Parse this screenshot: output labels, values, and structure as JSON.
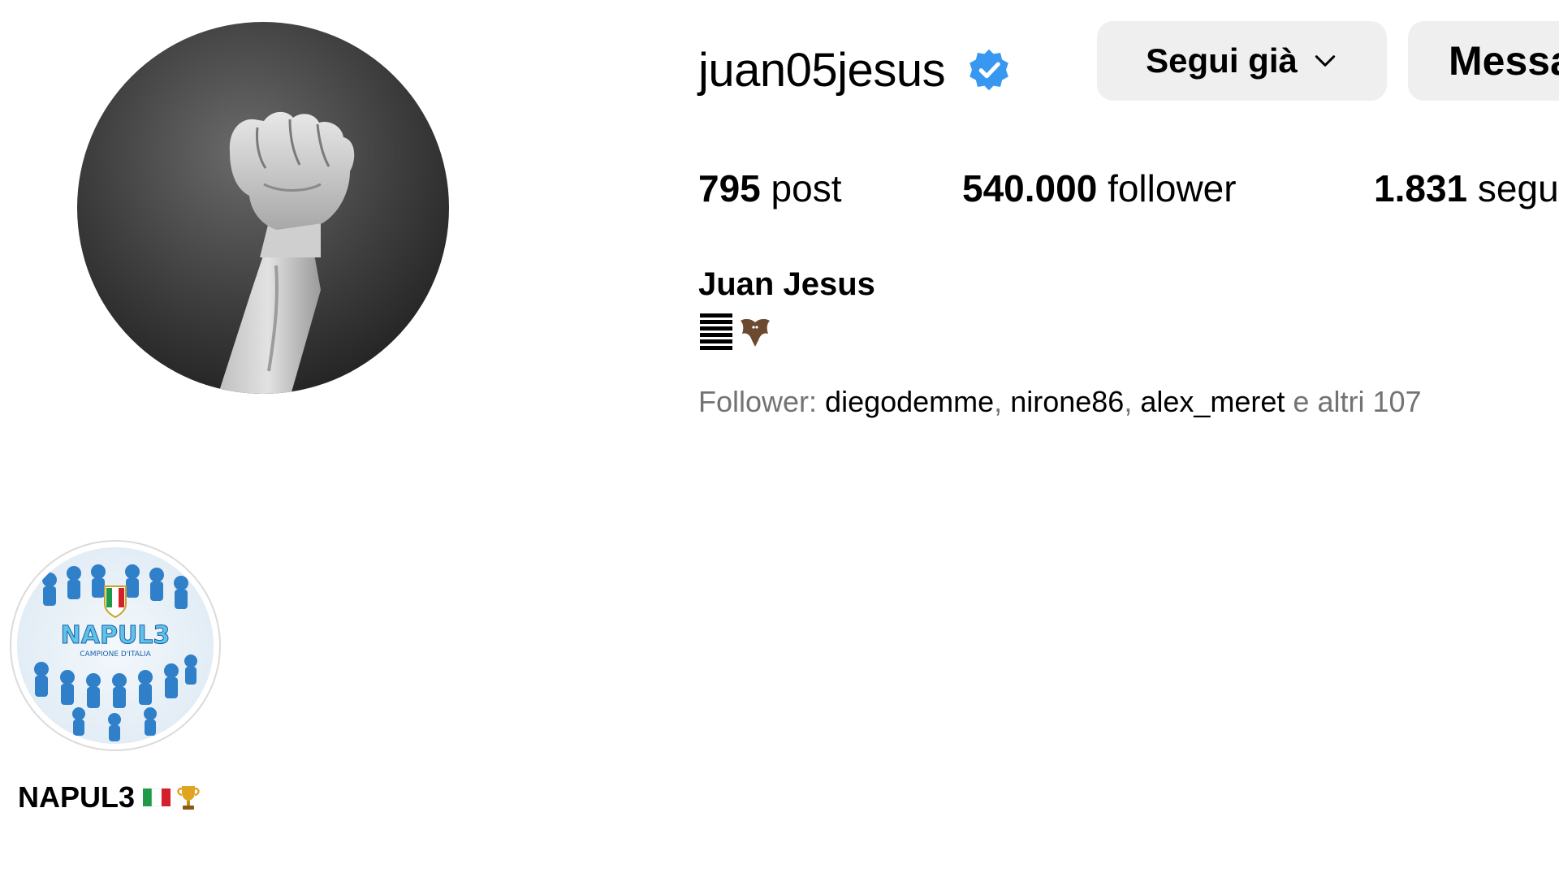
{
  "profile": {
    "username": "juan05jesus",
    "verified_icon": "verified-badge-icon",
    "full_name": "Juan Jesus",
    "bio_icons": [
      "stripes-icon",
      "bat-icon"
    ]
  },
  "actions": {
    "follow_label": "Segui già",
    "follow_icon": "chevron-down-icon",
    "message_label": "Messa"
  },
  "stats": {
    "posts_count": "795",
    "posts_label": "post",
    "followers_count": "540.000",
    "followers_label": "follower",
    "following_count": "1.831",
    "following_label": "segu"
  },
  "followed_by": {
    "prefix": "Follower: ",
    "accounts": [
      "diegodemme",
      "nirone86",
      "alex_meret"
    ],
    "separator": ", ",
    "suffix": " e altri 107"
  },
  "highlights": [
    {
      "label": "NAPUL3",
      "icons": [
        "italy-flag-icon",
        "trophy-icon"
      ],
      "image_text": "NAPUL3",
      "image_subtext": "CAMPIONE D'ITALIA"
    }
  ],
  "colors": {
    "verified_blue": "#3897f0",
    "button_bg": "#efefef",
    "muted_text": "#737373"
  }
}
